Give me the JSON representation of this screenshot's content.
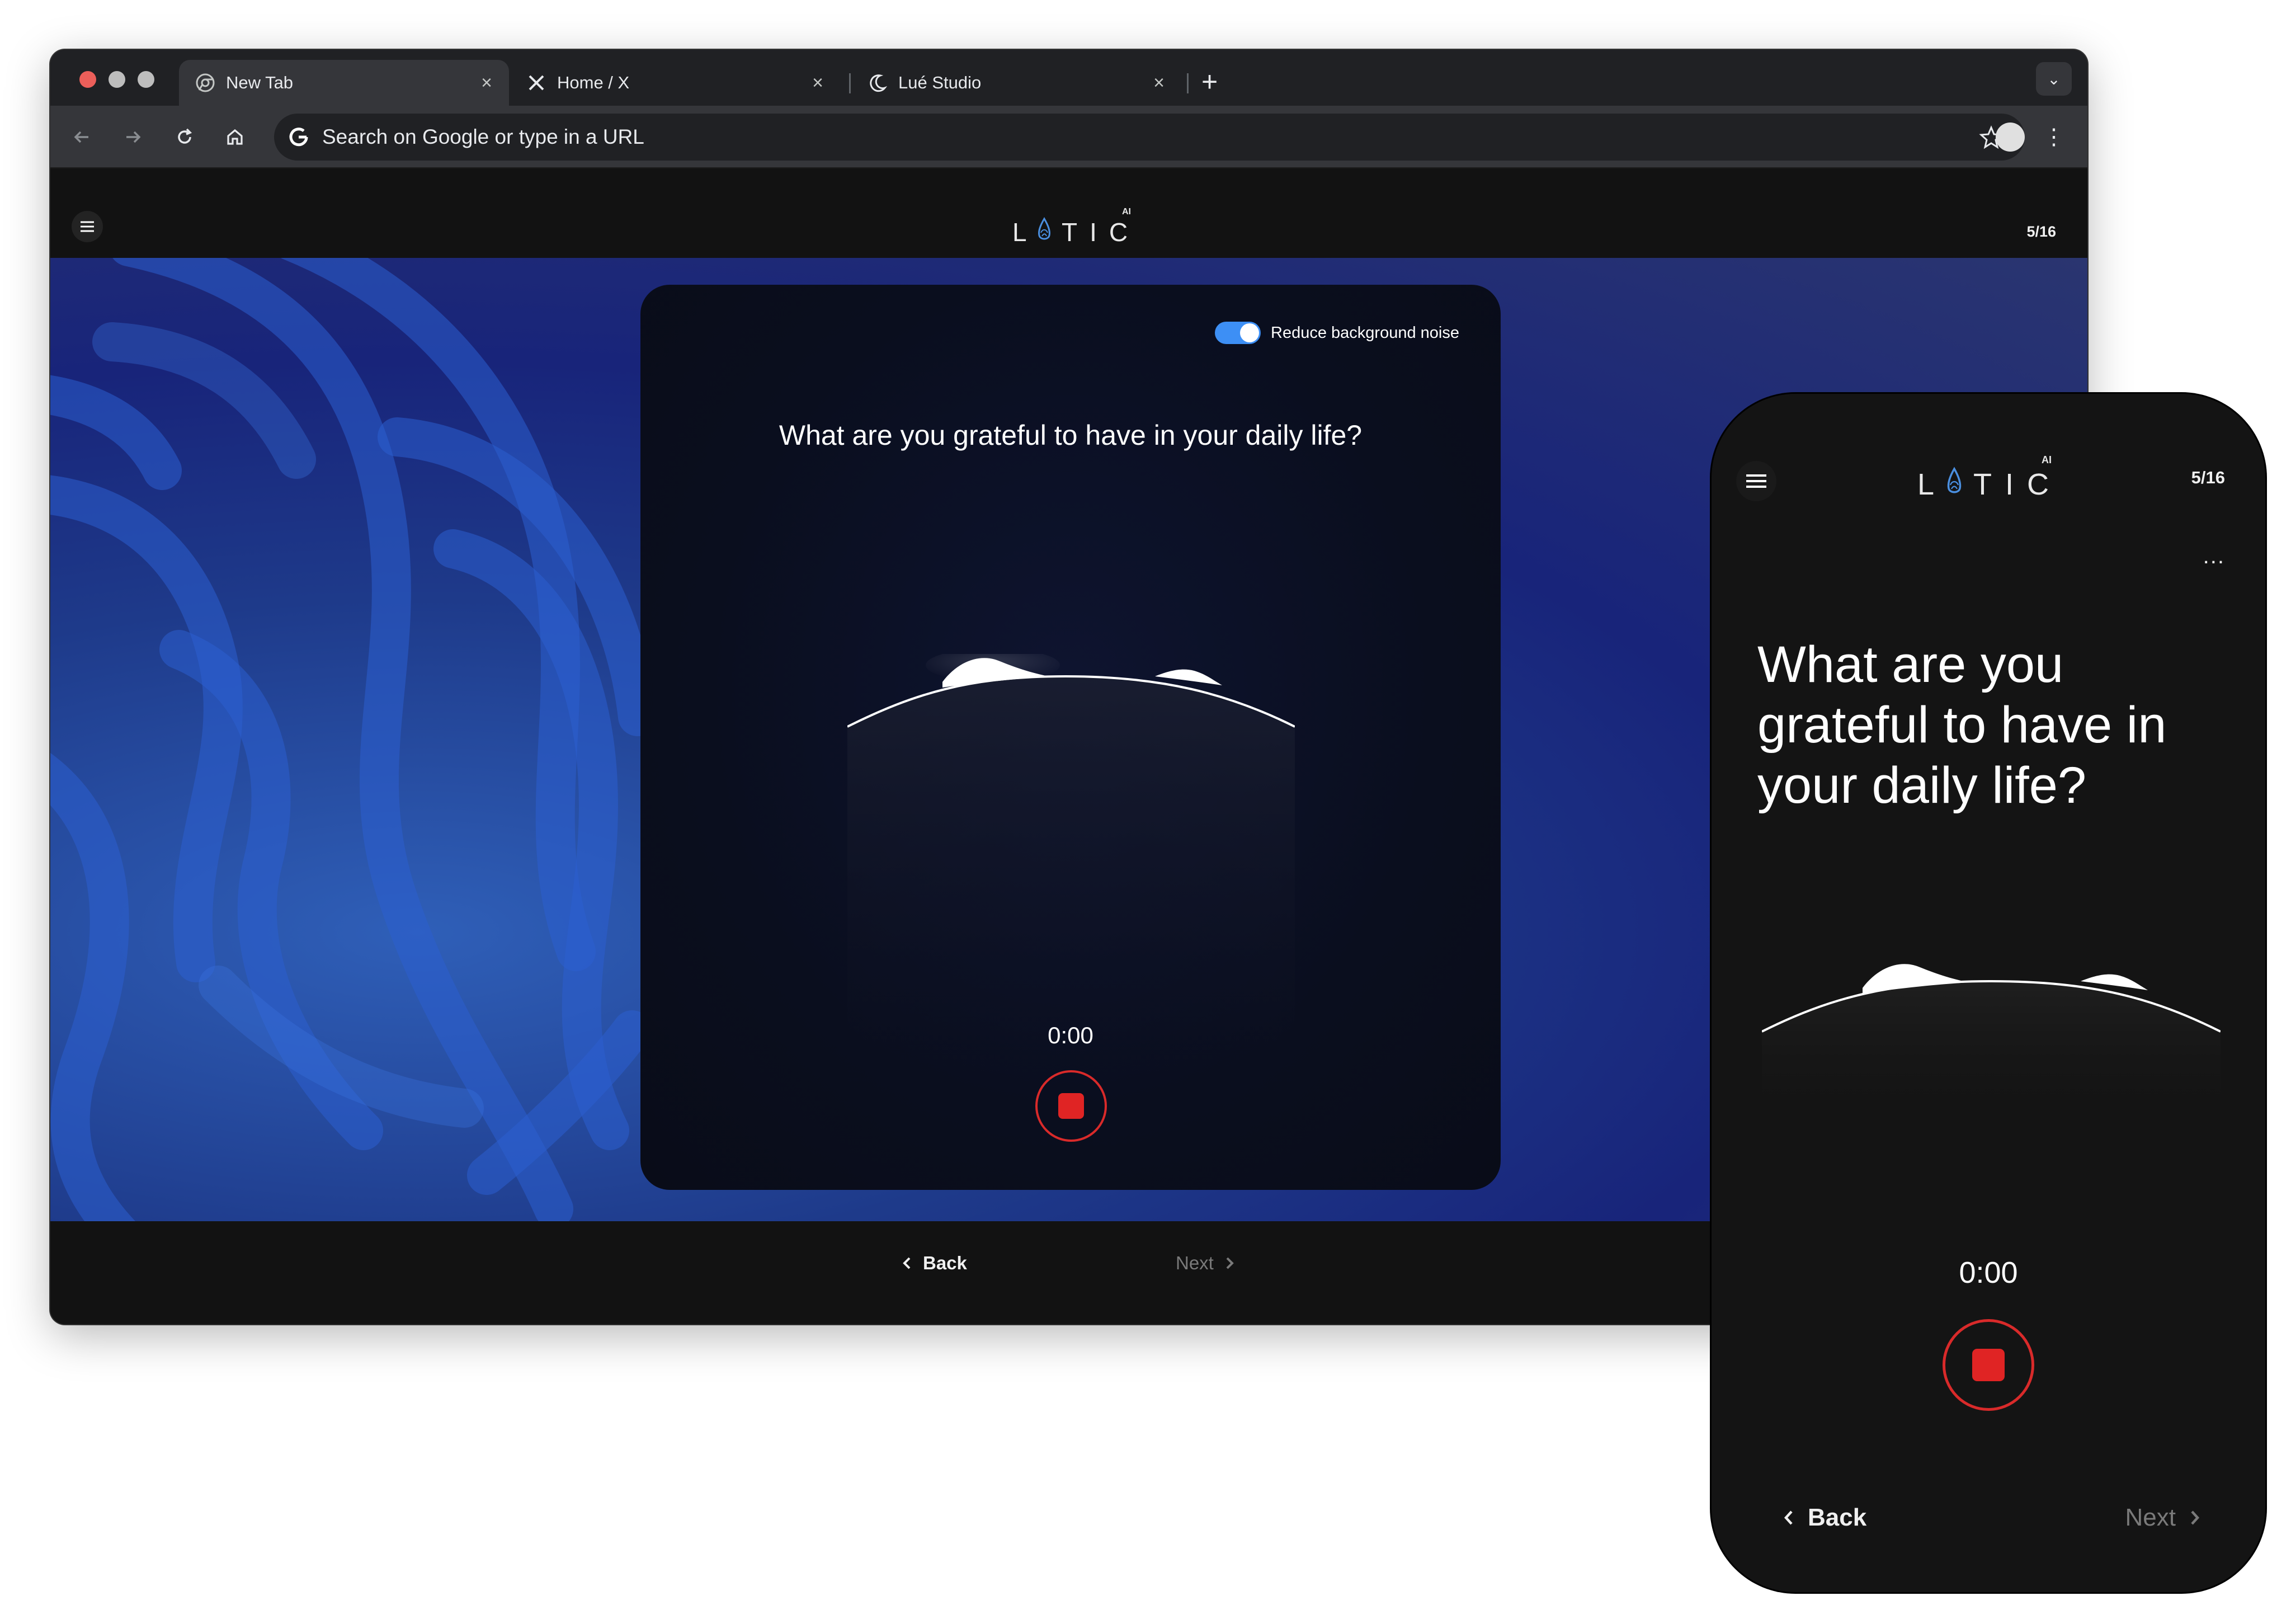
{
  "browser": {
    "tabs": [
      {
        "label": "New Tab",
        "icon": "chrome-icon",
        "active": true
      },
      {
        "label": "Home / X",
        "icon": "x-logo-icon",
        "active": false
      },
      {
        "label": "Lué Studio",
        "icon": "moon-icon",
        "active": false
      }
    ],
    "omnibox_placeholder": "Search on Google or type in a URL"
  },
  "app": {
    "brand": "LOTIC",
    "brand_superscript": "AI",
    "progress": "5/16",
    "noise_toggle_label": "Reduce background noise",
    "noise_toggle_on": true,
    "question": "What are you grateful to have in your daily life?",
    "timer": "0:00",
    "back_label": "Back",
    "next_label": "Next",
    "accent_color": "#3d8ff5",
    "record_color": "#e02424"
  },
  "phone": {
    "progress": "5/16",
    "more_label": "...",
    "question": "What are you grateful to have in your daily life?",
    "timer": "0:00",
    "back_label": "Back",
    "next_label": "Next"
  }
}
